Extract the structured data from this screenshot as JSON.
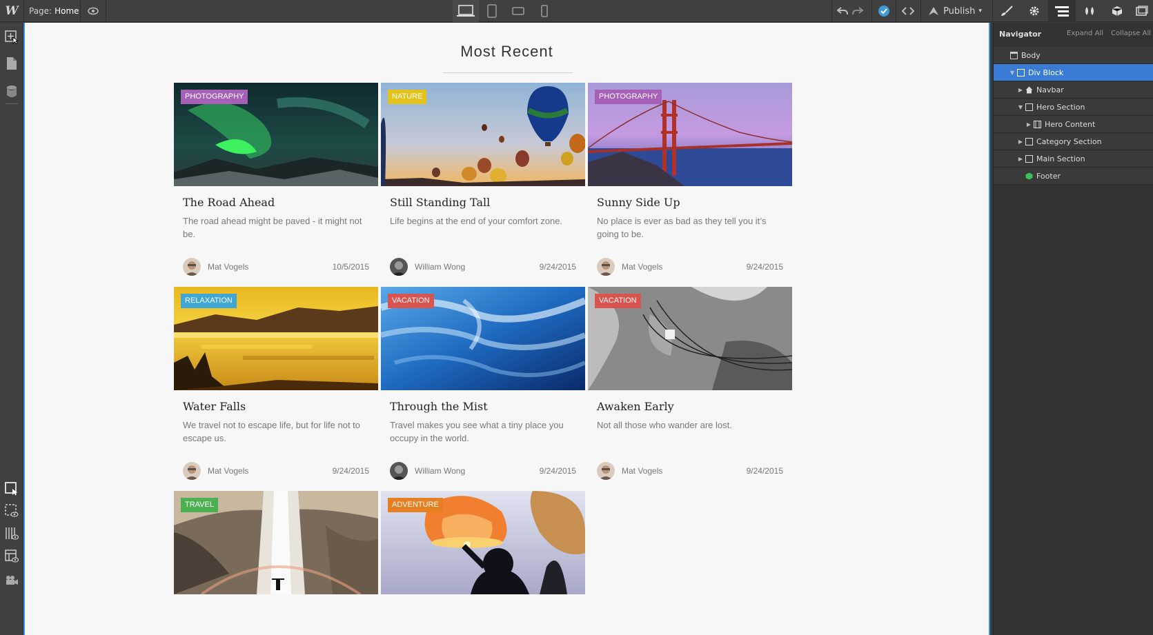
{
  "topbar": {
    "page_prefix": "Page:",
    "page_name": "Home",
    "publish_label": "Publish"
  },
  "canvas": {
    "section_title": "Most Recent",
    "cards": [
      {
        "category": "PHOTOGRAPHY",
        "category_color": "#a660b8",
        "title": "The Road Ahead",
        "desc": "The road ahead might be paved - it might not be.",
        "author": "Mat Vogels",
        "date": "10/5/2015"
      },
      {
        "category": "NATURE",
        "category_color": "#e4c21c",
        "title": "Still Standing Tall",
        "desc": "Life begins at the end of your comfort zone.",
        "author": "William Wong",
        "date": "9/24/2015"
      },
      {
        "category": "PHOTOGRAPHY",
        "category_color": "#a660b8",
        "title": "Sunny Side Up",
        "desc": "No place is ever as bad as they tell you it’s going to be.",
        "author": "Mat Vogels",
        "date": "9/24/2015"
      },
      {
        "category": "RELAXATION",
        "category_color": "#3fa7d6",
        "title": "Water Falls",
        "desc": "We travel not to escape life, but for life not to escape us.",
        "author": "Mat Vogels",
        "date": "9/24/2015"
      },
      {
        "category": "VACATION",
        "category_color": "#d9534f",
        "title": "Through the Mist",
        "desc": "Travel makes you see what a tiny place you occupy in the world.",
        "author": "William Wong",
        "date": "9/24/2015"
      },
      {
        "category": "VACATION",
        "category_color": "#d9534f",
        "title": "Awaken Early",
        "desc": "Not all those who wander are lost.",
        "author": "Mat Vogels",
        "date": "9/24/2015"
      },
      {
        "category": "TRAVEL",
        "category_color": "#4caf50",
        "title": "",
        "desc": "",
        "author": "",
        "date": ""
      },
      {
        "category": "ADVENTURE",
        "category_color": "#e67e22",
        "title": "",
        "desc": "",
        "author": "",
        "date": ""
      }
    ]
  },
  "navigator": {
    "title": "Navigator",
    "expand_all": "Expand All",
    "collapse_all": "Collapse All",
    "items": [
      {
        "label": "Body",
        "icon": "page-icon"
      },
      {
        "label": "Div Block",
        "icon": "box-icon"
      },
      {
        "label": "Navbar",
        "icon": "home-icon"
      },
      {
        "label": "Hero Section",
        "icon": "box-icon"
      },
      {
        "label": "Hero Content",
        "icon": "container-icon"
      },
      {
        "label": "Category Section",
        "icon": "box-icon"
      },
      {
        "label": "Main Section",
        "icon": "box-icon"
      },
      {
        "label": "Footer",
        "icon": "symbol-icon"
      }
    ]
  },
  "colors": {
    "accent": "#3e8fe6",
    "selected_row": "#3a7bd5"
  }
}
